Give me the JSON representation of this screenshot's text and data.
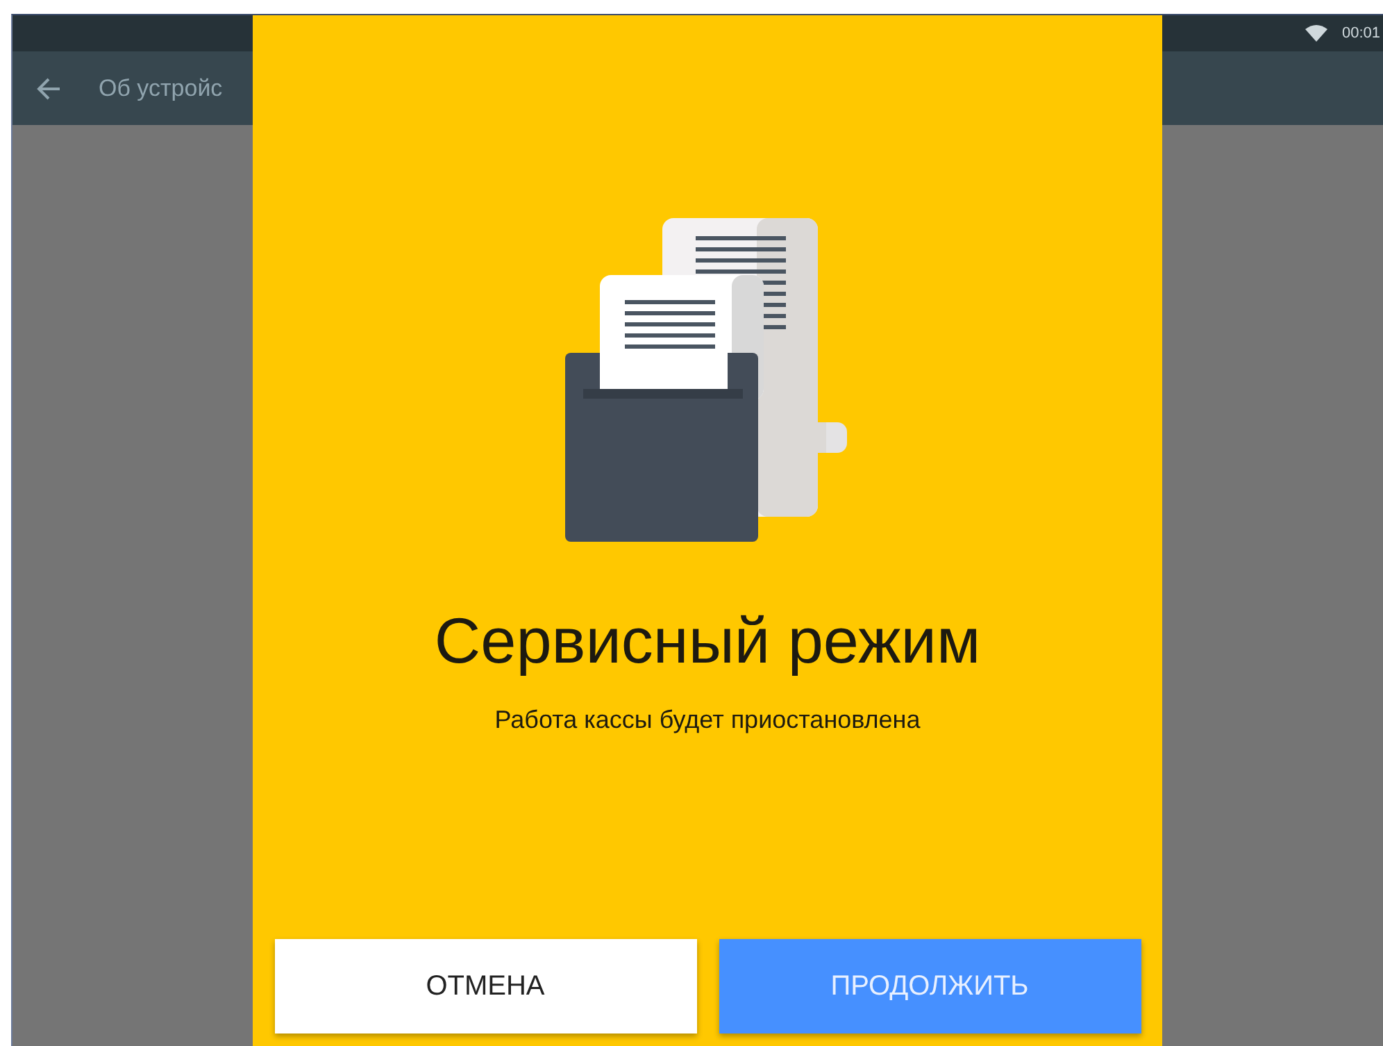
{
  "status_bar": {
    "time": "00:01"
  },
  "app_bar": {
    "title": "Об устройс"
  },
  "dialog": {
    "title": "Сервисный режим",
    "message": "Работа кассы будет приостановлена",
    "buttons": [
      {
        "label": "ОТМЕНА",
        "kind": "secondary"
      },
      {
        "label": "ПРОДОЛЖИТЬ",
        "kind": "primary"
      }
    ]
  }
}
